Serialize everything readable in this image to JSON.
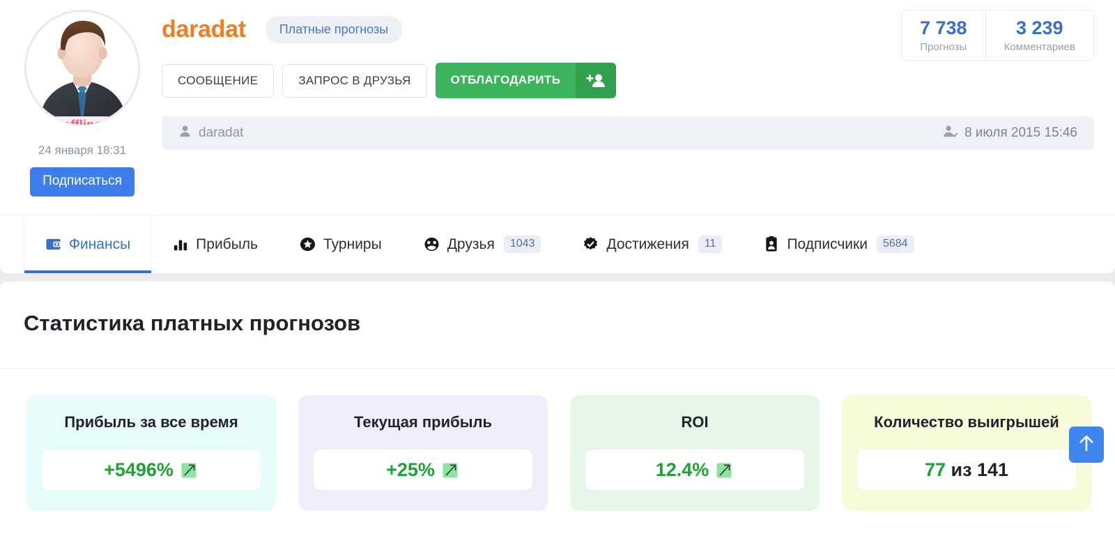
{
  "profile": {
    "username": "daradat",
    "badge": "Платные прогнозы",
    "status": "offline",
    "last_seen": "24 января 18:31",
    "subscribe_label": "Подписаться",
    "buttons": {
      "message": "СООБЩЕНИЕ",
      "friend_request": "ЗАПРОС В ДРУЗЬЯ",
      "thank": "ОТБЛАГОДАРИТЬ"
    },
    "info_strip": {
      "left_text": "daradat",
      "right_text": "8 июля 2015 15:46"
    },
    "counters": [
      {
        "value": "7 738",
        "label": "Прогнозы"
      },
      {
        "value": "3 239",
        "label": "Комментариев"
      }
    ]
  },
  "tabs": [
    {
      "label": "Финансы",
      "count": "",
      "active": true
    },
    {
      "label": "Прибыль",
      "count": "",
      "active": false
    },
    {
      "label": "Турниры",
      "count": "",
      "active": false
    },
    {
      "label": "Друзья",
      "count": "1043",
      "active": false
    },
    {
      "label": "Достижения",
      "count": "11",
      "active": false
    },
    {
      "label": "Подписчики",
      "count": "5684",
      "active": false
    }
  ],
  "stats": {
    "title": "Статистика платных прогнозов",
    "cards": [
      {
        "title": "Прибыль за все время",
        "value": "+5496%",
        "trend": "up",
        "bg": "#e8fbfb"
      },
      {
        "title": "Текущая прибыль",
        "value": "+25%",
        "trend": "up",
        "bg": "#efedfb"
      },
      {
        "title": "ROI",
        "value": "12.4%",
        "trend": "up",
        "bg": "#e5f6e8"
      },
      {
        "title": "Количество выигрышей",
        "value_green": "77",
        "value_rest": " из 141",
        "trend": "none",
        "bg": "#f8fbda"
      }
    ]
  },
  "colors": {
    "accent_blue": "#3a6fc4",
    "brand_orange": "#f07c23",
    "green": "#1ba334",
    "subscribe_blue": "#3d7eec"
  }
}
